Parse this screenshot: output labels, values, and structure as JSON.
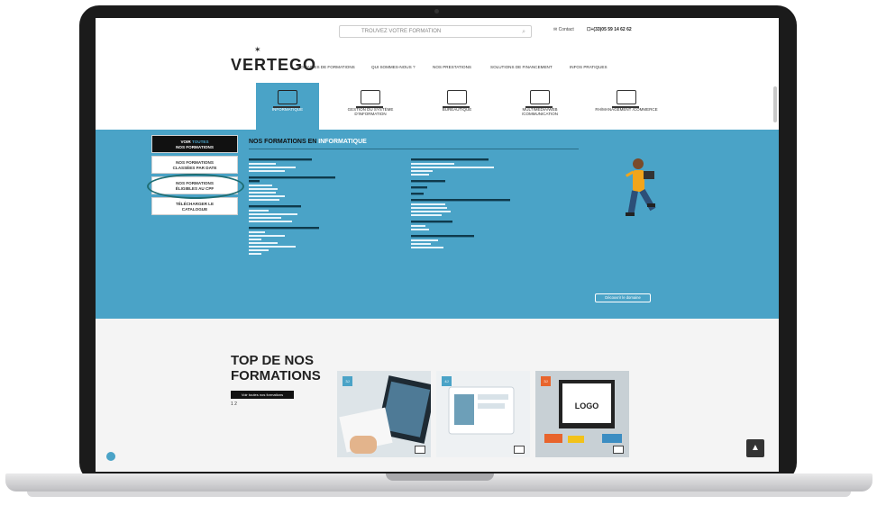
{
  "header": {
    "search_placeholder": "TROUVEZ VOTRE FORMATION",
    "contact_label": "Contact",
    "phone": "+(33)05 59 14 62 62",
    "logo": "VERTEGO"
  },
  "nav": [
    "DOMAINES DE FORMATIONS",
    "QUI SOMMES-NOUS ?",
    "NOS PRESTATIONS",
    "SOLUTIONS DE FINANCEMENT",
    "INFOS PRATIQUES"
  ],
  "categories": [
    {
      "label": "INFORMATIQUE",
      "icon": "laptop-icon"
    },
    {
      "label": "GESTION DU SYSTÈME D'INFORMATION",
      "icon": "monitor-icon"
    },
    {
      "label": "BUREAUTIQUE",
      "icon": "desktop-icon"
    },
    {
      "label": "MULTIMEDIA/WEB /COMMUNICATION",
      "icon": "screen-icon"
    },
    {
      "label": "RH/MANAGEMENT /COMMERCE",
      "icon": "people-icon"
    }
  ],
  "sidebar": {
    "all": {
      "line1_hl": "TOUTES",
      "line1": "VOIR",
      "line2": "NOS FORMATIONS"
    },
    "by_date": {
      "line1": "NOS FORMATIONS",
      "line2": "CLASSÉES PAR DATE"
    },
    "cpf": {
      "line1": "NOS FORMATIONS",
      "line2": "ÉLIGIBLES AU CPF"
    },
    "catalogue": {
      "line1": "TÉLÉCHARGER LE",
      "line2": "CATALOGUE"
    }
  },
  "mega": {
    "title_a": "NOS FORMATIONS EN ",
    "title_b": "INFORMATIQUE",
    "discover": "Découvrir le domaine"
  },
  "lower": {
    "title": "TOP DE NOS FORMATIONS",
    "all_button": "Voir toutes nos formations",
    "pager": "1 2",
    "badges": [
      "3J",
      "4J",
      "3J"
    ]
  },
  "colors": {
    "accent": "#4aa3c7",
    "dark": "#111111",
    "badge_blue": "#4aa3c7",
    "badge_orange": "#e8642c"
  }
}
